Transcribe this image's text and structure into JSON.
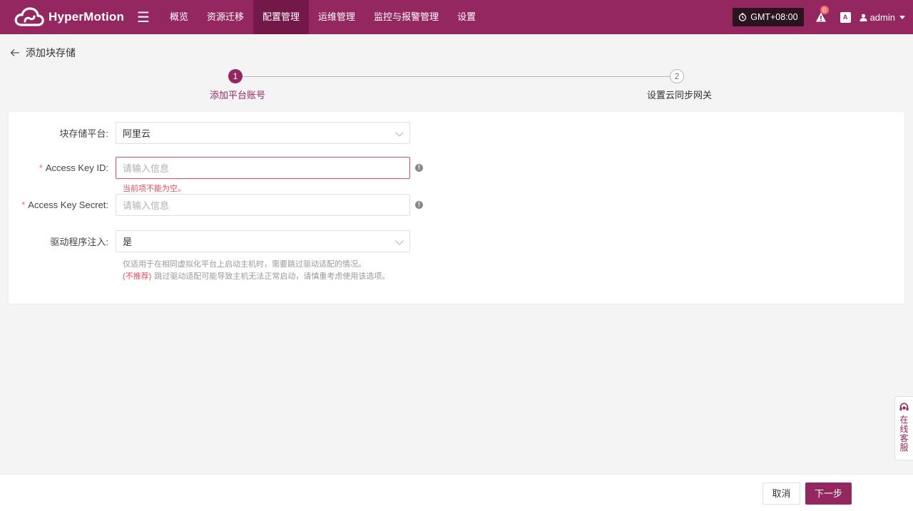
{
  "topbar": {
    "brand": "HyperMotion",
    "nav": [
      "概览",
      "资源迁移",
      "配置管理",
      "运维管理",
      "监控与报警管理",
      "设置"
    ],
    "active_index": 2,
    "timezone": "GMT+08:00",
    "alert_count": "0",
    "lang_label": "A",
    "user": "admin",
    "colors": {
      "brand": "#952760",
      "active": "#74184a"
    }
  },
  "page": {
    "title": "添加块存储"
  },
  "steps": [
    {
      "num": "1",
      "label": "添加平台账号"
    },
    {
      "num": "2",
      "label": "设置云同步网关"
    }
  ],
  "form": {
    "platform_label": "块存储平台:",
    "platform_value": "阿里云",
    "akid_required": "*",
    "akid_label": "Access Key ID:",
    "akid_placeholder": "请输入信息",
    "akid_error": "当前项不能为空。",
    "aks_required": "*",
    "aks_label": "Access Key Secret:",
    "aks_placeholder": "请输入信息",
    "driver_label": "驱动程序注入:",
    "driver_value": "是",
    "help_line1": "仅适用于在相同虚拟化平台上启动主机时，需要跳过驱动适配的情况。",
    "help_warn": "(不推荐)",
    "help_line2": "跳过驱动适配可能导致主机无法正常启动，请慎重考虑使用该选项。",
    "info_glyph": "!"
  },
  "footer": {
    "cancel": "取消",
    "next": "下一步"
  },
  "side": {
    "label": "在线客服"
  }
}
